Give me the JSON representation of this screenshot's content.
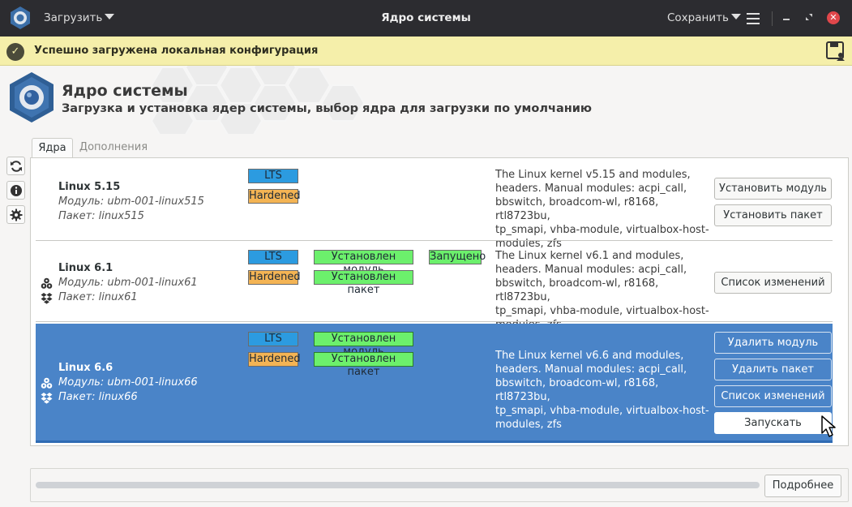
{
  "titlebar": {
    "load_menu": "Загрузить",
    "title": "Ядро системы",
    "save_menu": "Сохранить"
  },
  "infobar": {
    "message": "Успешно загружена локальная конфигурация"
  },
  "header": {
    "title": "Ядро системы",
    "subtitle": "Загрузка и установка ядер системы, выбор ядра для загрузки по умолчанию"
  },
  "tabs": [
    {
      "label": "Ядра"
    },
    {
      "label": "Дополнения"
    }
  ],
  "kernels": [
    {
      "name": "Linux 5.15",
      "module": "Модуль: ubm-001-linux515",
      "package": "Пакет: linux515",
      "badges": [
        "LTS",
        "Hardened"
      ],
      "description": [
        "The Linux kernel v5.15 and modules,",
        "headers. Manual modules: acpi_call,",
        "bbswitch, broadcom-wl, r8168, rtl8723bu,",
        "tp_smapi, vhba-module, virtualbox-host-",
        "modules, zfs"
      ],
      "buttons": [
        "Установить модуль",
        "Установить пакет"
      ]
    },
    {
      "name": "Linux 6.1",
      "module": "Модуль: ubm-001-linux61",
      "package": "Пакет: linux61",
      "badges": [
        "LTS",
        "Hardened",
        "Установлен модуль",
        "Установлен пакет",
        "Запущено"
      ],
      "description": [
        "The Linux kernel v6.1 and modules,",
        "headers. Manual modules: acpi_call,",
        "bbswitch, broadcom-wl, r8168, rtl8723bu,",
        "tp_smapi, vhba-module, virtualbox-host-",
        "modules, zfs"
      ],
      "buttons": [
        "Список изменений"
      ]
    },
    {
      "name": "Linux 6.6",
      "module": "Модуль: ubm-001-linux66",
      "package": "Пакет: linux66",
      "badges": [
        "LTS",
        "Hardened",
        "Установлен модуль",
        "Установлен пакет"
      ],
      "description": [
        "The Linux kernel v6.6 and modules,",
        "headers. Manual modules: acpi_call,",
        "bbswitch, broadcom-wl, r8168, rtl8723bu,",
        "tp_smapi, vhba-module, virtualbox-host-",
        "modules, zfs"
      ],
      "buttons": [
        "Удалить модуль",
        "Удалить пакет",
        "Список изменений",
        "Запускать"
      ]
    }
  ],
  "footer": {
    "more_button": "Подробнее"
  },
  "icons": {
    "app": "gear-logo-icon",
    "status": "check-circle-icon",
    "save_profile": "save-profile-icon",
    "side": [
      "refresh-icon",
      "info-icon",
      "settings-icon"
    ],
    "module": "module-icon",
    "package": "dropbox-package-icon"
  },
  "colors": {
    "titlebar": "#2c2c30",
    "infobar": "#f5efaa",
    "selection": "#4a84c8",
    "lts": "#2c9be0",
    "hardened": "#f4b454",
    "installed": "#6cf06c",
    "close": "#e0474b"
  }
}
